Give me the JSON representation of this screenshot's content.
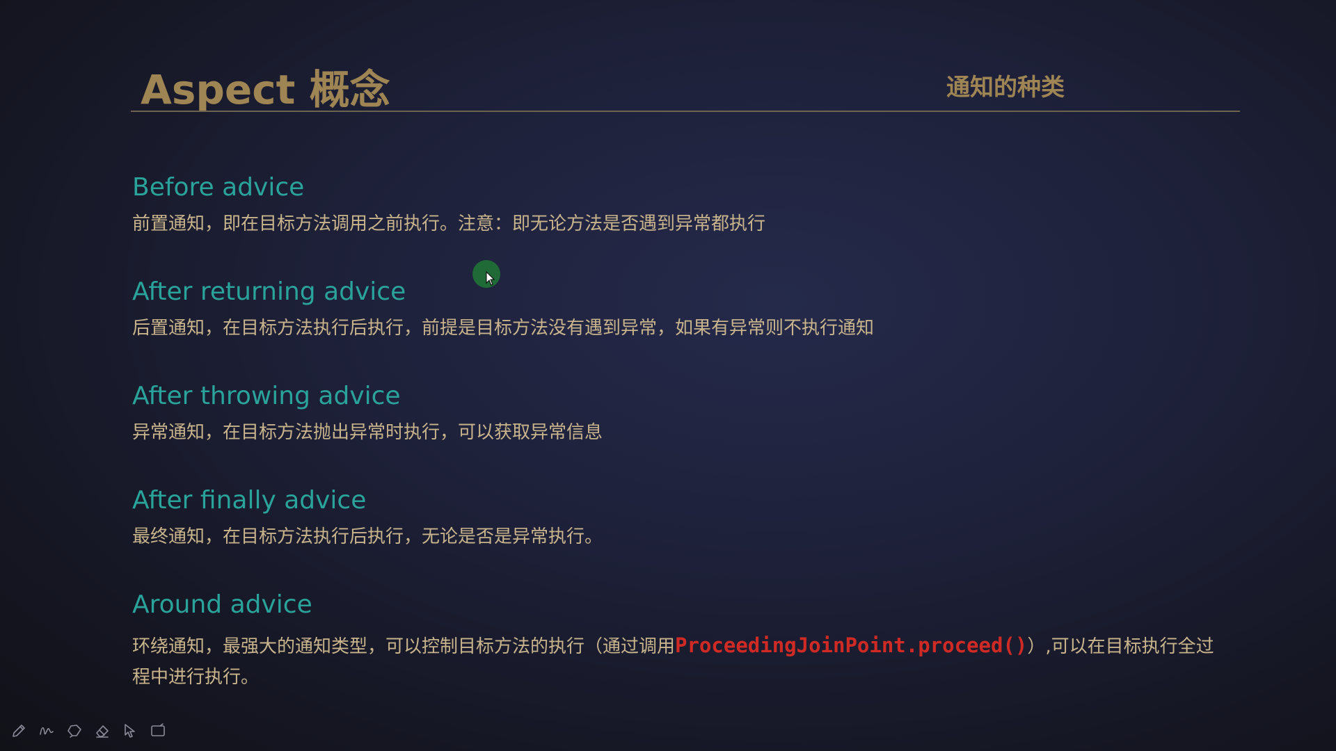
{
  "slide": {
    "title": "Aspect 概念",
    "subtitle": "通知的种类"
  },
  "advices": [
    {
      "heading": "Before advice",
      "desc": "前置通知，即在目标方法调用之前执行。注意：即无论方法是否遇到异常都执行"
    },
    {
      "heading": "After returning advice",
      "desc": "后置通知，在目标方法执行后执行，前提是目标方法没有遇到异常，如果有异常则不执行通知"
    },
    {
      "heading": "After throwing advice",
      "desc": "异常通知，在目标方法抛出异常时执行，可以获取异常信息"
    },
    {
      "heading": "After finally advice",
      "desc": "最终通知，在目标方法执行后执行，无论是否是异常执行。"
    },
    {
      "heading": "Around advice",
      "desc_before": "环绕通知，最强大的通知类型，可以控制目标方法的执行（通过调用",
      "code": "ProceedingJoinPoint.proceed()",
      "desc_after": "）,可以在目标执行全过程中进行执行。"
    }
  ],
  "toolbar": {
    "tools": [
      "pen-icon",
      "freehand-icon",
      "lasso-icon",
      "eraser-icon",
      "pointer-icon",
      "screen-icon"
    ]
  },
  "colors": {
    "title": "#a08554",
    "heading": "#2aa39a",
    "body": "#c9b48c",
    "code": "#d02a25"
  }
}
